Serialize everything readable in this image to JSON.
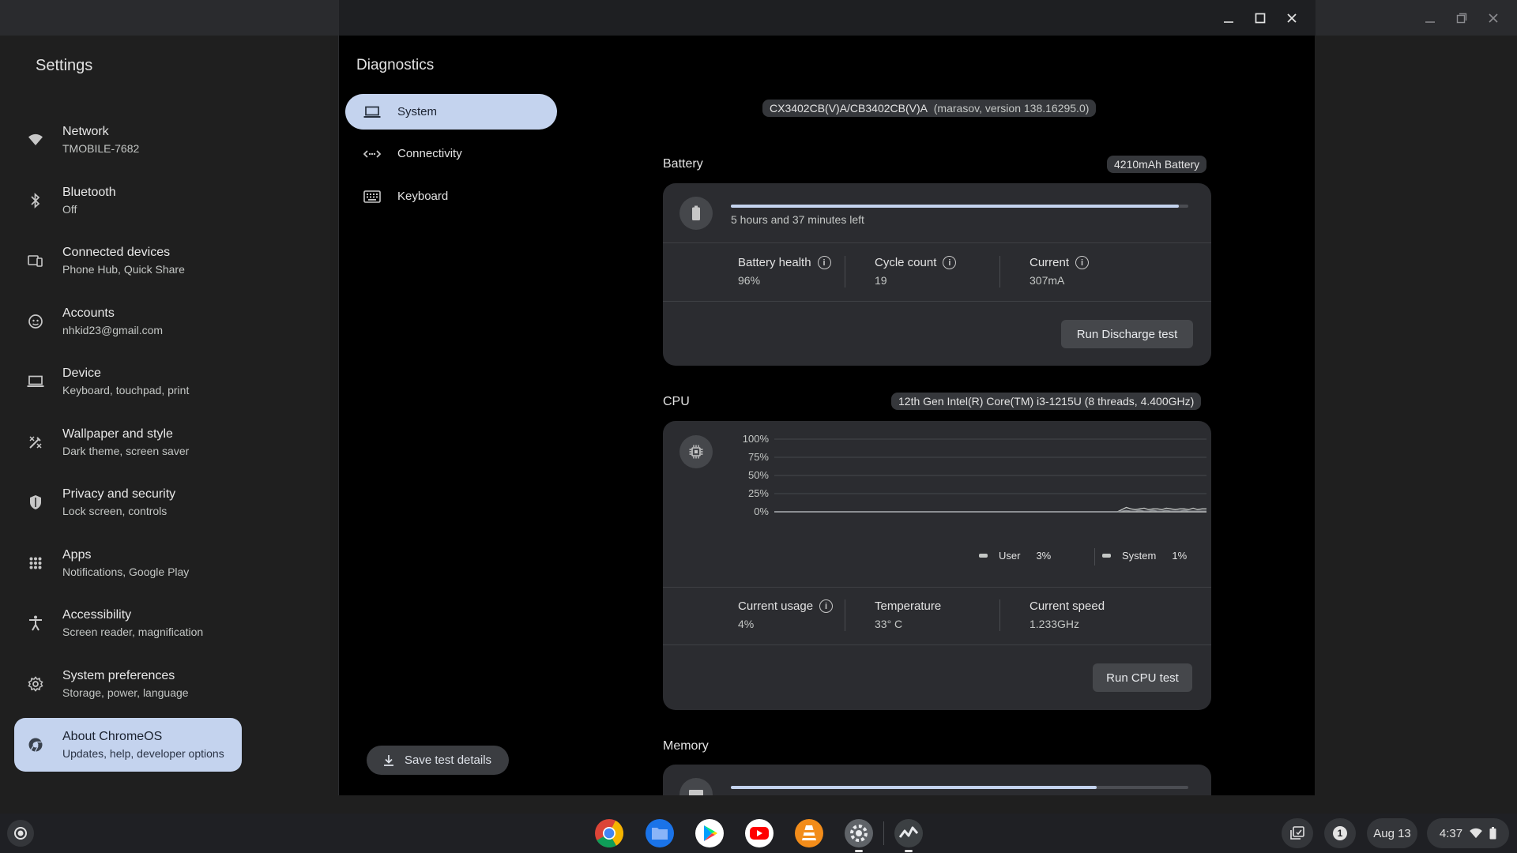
{
  "settings": {
    "title": "Settings",
    "nav": [
      {
        "label": "Network",
        "sub": "TMOBILE-7682",
        "icon": "wifi-icon"
      },
      {
        "label": "Bluetooth",
        "sub": "Off",
        "icon": "bluetooth-icon"
      },
      {
        "label": "Connected devices",
        "sub": "Phone Hub, Quick Share",
        "icon": "connected-devices-icon"
      },
      {
        "label": "Accounts",
        "sub": "nhkid23@gmail.com",
        "icon": "accounts-icon"
      },
      {
        "label": "Device",
        "sub": "Keyboard, touchpad, print",
        "icon": "laptop-icon"
      },
      {
        "label": "Wallpaper and style",
        "sub": "Dark theme, screen saver",
        "icon": "paintbrush-icon"
      },
      {
        "label": "Privacy and security",
        "sub": "Lock screen, controls",
        "icon": "shield-icon"
      },
      {
        "label": "Apps",
        "sub": "Notifications, Google Play",
        "icon": "apps-grid-icon"
      },
      {
        "label": "Accessibility",
        "sub": "Screen reader, magnification",
        "icon": "accessibility-icon"
      },
      {
        "label": "System preferences",
        "sub": "Storage, power, language",
        "icon": "gear-icon"
      },
      {
        "label": "About ChromeOS",
        "sub": "Updates, help, developer options",
        "icon": "chromeos-icon",
        "selected": true
      }
    ]
  },
  "diagnostics": {
    "title": "Diagnostics",
    "nav": [
      {
        "label": "System",
        "icon": "laptop-icon",
        "selected": true
      },
      {
        "label": "Connectivity",
        "icon": "connectivity-icon"
      },
      {
        "label": "Keyboard",
        "icon": "keyboard-icon"
      }
    ],
    "save_label": "Save test details",
    "device_model": "CX3402CB(V)A/CB3402CB(V)A",
    "device_version": "(marasov, version 138.16295.0)",
    "battery": {
      "title": "Battery",
      "capacity": "4210mAh Battery",
      "time_left": "5 hours and 37 minutes left",
      "charge_fraction": 0.98,
      "health_label": "Battery health",
      "health_value": "96%",
      "cycle_label": "Cycle count",
      "cycle_value": "19",
      "current_label": "Current",
      "current_value": "307mA",
      "run_label": "Run Discharge test"
    },
    "cpu": {
      "title": "CPU",
      "model": "12th Gen Intel(R) Core(TM) i3-1215U (8 threads, 4.400GHz)",
      "legend_user_label": "User",
      "legend_user_value": "3%",
      "legend_system_label": "System",
      "legend_system_value": "1%",
      "usage_label": "Current usage",
      "usage_value": "4%",
      "temp_label": "Temperature",
      "temp_value": "33° C",
      "speed_label": "Current speed",
      "speed_value": "1.233GHz",
      "run_label": "Run CPU test"
    },
    "memory": {
      "title": "Memory",
      "used_fraction": 0.8
    }
  },
  "chart_data": {
    "type": "line",
    "ylim": [
      0,
      100
    ],
    "y_ticks": [
      "100%",
      "75%",
      "50%",
      "25%",
      "0%"
    ],
    "grid": true,
    "series": [
      {
        "name": "User",
        "values": [
          0,
          0,
          0,
          0,
          0,
          0,
          0,
          0,
          0,
          0,
          0,
          0,
          0,
          0,
          0,
          0,
          0,
          0,
          0,
          0,
          0,
          0,
          0,
          0,
          0,
          0,
          0,
          0,
          0,
          0,
          0,
          0,
          0,
          0,
          0,
          0,
          0,
          0,
          0,
          0,
          0,
          0,
          0,
          0,
          0,
          0,
          0,
          0,
          0,
          0,
          0,
          0,
          0,
          0,
          0,
          0,
          0,
          0,
          0,
          0,
          0,
          0,
          0,
          0,
          0,
          0,
          0,
          0,
          0,
          0,
          0,
          0,
          0,
          0,
          0,
          0,
          0,
          0,
          3,
          6,
          4,
          3,
          4,
          5,
          3,
          4,
          4,
          3,
          5,
          4,
          3,
          4,
          4,
          3,
          5,
          3,
          4,
          4
        ]
      },
      {
        "name": "System",
        "values": [
          0,
          0,
          0,
          0,
          0,
          0,
          0,
          0,
          0,
          0,
          0,
          0,
          0,
          0,
          0,
          0,
          0,
          0,
          0,
          0,
          0,
          0,
          0,
          0,
          0,
          0,
          0,
          0,
          0,
          0,
          0,
          0,
          0,
          0,
          0,
          0,
          0,
          0,
          0,
          0,
          0,
          0,
          0,
          0,
          0,
          0,
          0,
          0,
          0,
          0,
          0,
          0,
          0,
          0,
          0,
          0,
          0,
          0,
          0,
          0,
          0,
          0,
          0,
          0,
          0,
          0,
          0,
          0,
          0,
          0,
          0,
          0,
          0,
          0,
          0,
          0,
          0,
          0,
          1,
          2,
          1,
          1,
          2,
          1,
          1,
          2,
          1,
          1,
          2,
          1,
          1,
          1,
          2,
          1,
          1,
          1,
          1,
          1
        ]
      }
    ]
  },
  "shelf": {
    "date": "Aug 13",
    "time": "4:37",
    "notification_count": "1",
    "apps": [
      "chrome-icon",
      "files-icon",
      "play-store-icon",
      "youtube-icon",
      "vlc-icon",
      "settings-app-icon",
      "diagnostics-app-icon"
    ]
  }
}
